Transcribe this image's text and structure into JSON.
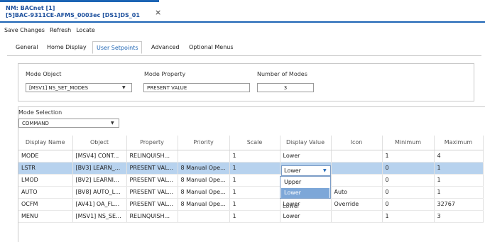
{
  "window_tab": {
    "line1": "NM: BACnet [1]",
    "line2": "[5]BAC-9311CE-AFMS_0003ec [DS1]DS_01",
    "close_glyph": "×",
    "accent": "#1c64b4"
  },
  "toolbar": {
    "save_label": "Save Changes",
    "refresh_label": "Refresh",
    "locate_label": "Locate"
  },
  "tabs": {
    "general": "General",
    "home_display": "Home Display",
    "user_setpoints": "User Setpoints",
    "advanced": "Advanced",
    "optional_menus": "Optional Menus"
  },
  "mode": {
    "object_label": "Mode Object",
    "object_value": "[MSV1] NS_SET_MODES",
    "property_label": "Mode Property",
    "property_value": "PRESENT VALUE",
    "number_label": "Number of Modes",
    "number_value": "3",
    "selection_label": "Mode Selection",
    "selection_value": "COMMAND"
  },
  "grid": {
    "columns": [
      "Display Name",
      "Object",
      "Property",
      "Priority",
      "Scale",
      "Display Value",
      "Icon",
      "Minimum",
      "Maximum"
    ],
    "rows": [
      [
        "MODE",
        "[MSV4] CONT...",
        "RELINQUISH...",
        "",
        "1",
        "Lower",
        "",
        "1",
        "4"
      ],
      [
        "LSTR",
        "[BV3] LEARN_...",
        "PRESENT VAL...",
        "8 Manual Ope...",
        "1",
        "Lower",
        "",
        "0",
        "1"
      ],
      [
        "LMOD",
        "[BV2] LEARNI...",
        "PRESENT VAL...",
        "8 Manual Ope...",
        "1",
        "Upper",
        "",
        "0",
        "1"
      ],
      [
        "AUTO",
        "[BV8] AUTO_L...",
        "PRESENT VAL...",
        "8 Manual Ope...",
        "1",
        "Lower",
        "Auto",
        "0",
        "1"
      ],
      [
        "OCFM",
        "[AV41] OA_FL...",
        "PRESENT VAL...",
        "8 Manual Ope...",
        "1",
        "Lower",
        "Override",
        "0",
        "32767"
      ],
      [
        "MENU",
        "[MSV1] NS_SE...",
        "RELINQUISH...",
        "",
        "1",
        "Lower",
        "",
        "1",
        "3"
      ]
    ],
    "selected_row": 1,
    "dropdown_options": [
      "Upper",
      "Lower"
    ],
    "dropdown_highlight": "Lower"
  }
}
